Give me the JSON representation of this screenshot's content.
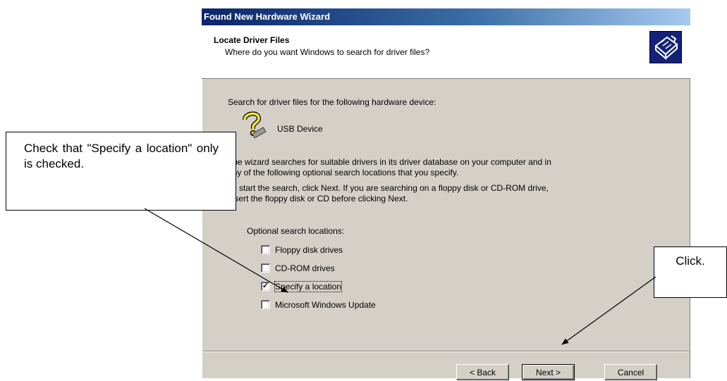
{
  "window": {
    "title": "Found New Hardware Wizard"
  },
  "header": {
    "title": "Locate Driver Files",
    "subtitle": "Where do you want Windows to search for driver files?"
  },
  "body": {
    "intro": "Search for driver files for the following hardware device:",
    "device_name": "USB Device",
    "paragraph1_line1": "The wizard searches for suitable drivers in its driver database on your computer and in",
    "paragraph1_line2": "any of the following optional search locations that you specify.",
    "paragraph2_line1": "To start the search, click Next. If you are searching on a floppy disk or CD-ROM drive,",
    "paragraph2_line2": "insert the floppy disk or CD before clicking Next.",
    "options_heading": "Optional search locations:"
  },
  "options": [
    {
      "label": "Floppy disk drives",
      "checked": false
    },
    {
      "label": "CD-ROM drives",
      "checked": false
    },
    {
      "label": "Specify a location",
      "checked": true
    },
    {
      "label": "Microsoft Windows Update",
      "checked": false
    }
  ],
  "buttons": {
    "back": "< Back",
    "next": "Next >",
    "cancel": "Cancel"
  },
  "annotations": {
    "left_callout": "Check that \"Specify a location\" only is checked.",
    "right_callout": "Click."
  },
  "icons": {
    "header_icon": "hardware-card-icon",
    "device_icon": "question-mark-device-icon"
  }
}
